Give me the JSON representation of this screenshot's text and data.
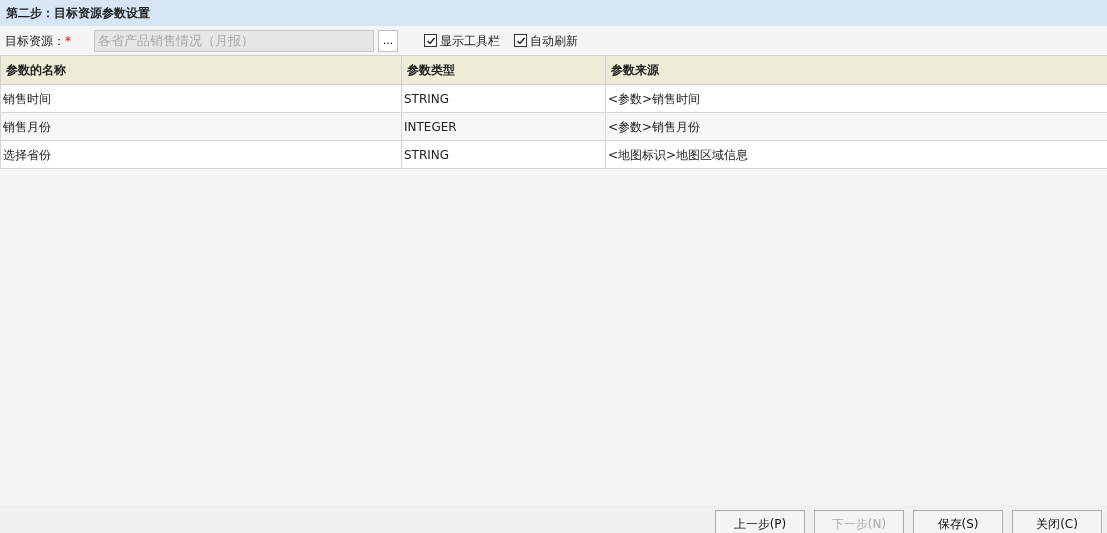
{
  "title": "第二步：目标资源参数设置",
  "target": {
    "label": "目标资源：",
    "required_mark": "*",
    "value": "各省产品销售情况（月报）",
    "disabled": true,
    "browse": "..."
  },
  "options": [
    {
      "label": "显示工具栏",
      "checked": true
    },
    {
      "label": "自动刷新",
      "checked": true
    }
  ],
  "table": {
    "columns": [
      "参数的名称",
      "参数类型",
      "参数来源"
    ],
    "rows": [
      {
        "cells": [
          "销售时间",
          "STRING",
          "<参数>销售时间"
        ]
      },
      {
        "cells": [
          "销售月份",
          "INTEGER",
          "<参数>销售月份"
        ]
      },
      {
        "cells": [
          "选择省份",
          "STRING",
          "<地图标识>地图区域信息"
        ]
      }
    ]
  },
  "buttons": [
    {
      "label": "上一步(P)",
      "disabled": false
    },
    {
      "label": "下一步(N)",
      "disabled": true
    },
    {
      "label": "保存(S)",
      "disabled": false
    },
    {
      "label": "关闭(C)",
      "disabled": false
    }
  ]
}
